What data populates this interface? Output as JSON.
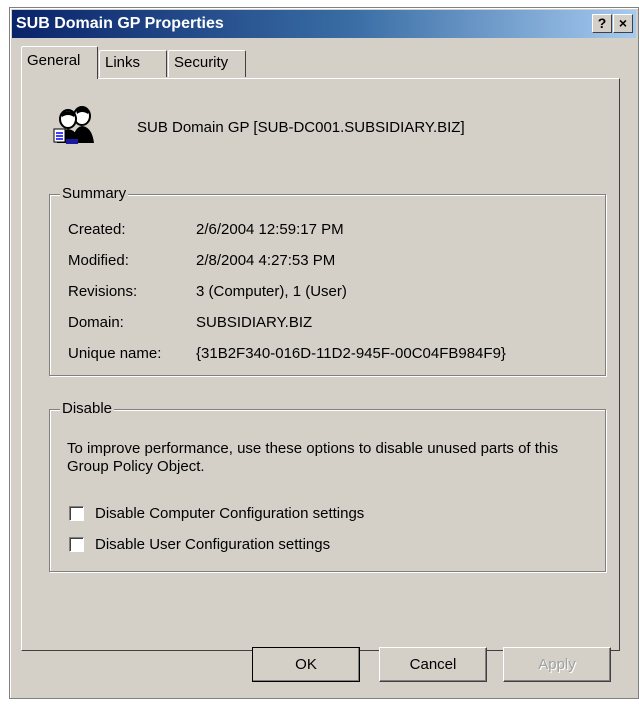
{
  "window": {
    "title": "SUB Domain GP Properties",
    "help_label": "?",
    "close_label": "×"
  },
  "tabs": [
    {
      "label": "General",
      "active": true
    },
    {
      "label": "Links",
      "active": false
    },
    {
      "label": "Security",
      "active": false
    }
  ],
  "header": {
    "icon": "group-policy-users-icon",
    "name": "SUB Domain GP [SUB-DC001.SUBSIDIARY.BIZ]"
  },
  "summary": {
    "legend": "Summary",
    "rows": [
      {
        "label": "Created:",
        "value": "2/6/2004 12:59:17 PM"
      },
      {
        "label": "Modified:",
        "value": "2/8/2004 4:27:53 PM"
      },
      {
        "label": "Revisions:",
        "value": "3 (Computer), 1 (User)"
      },
      {
        "label": "Domain:",
        "value": "SUBSIDIARY.BIZ"
      },
      {
        "label": "Unique name:",
        "value": "{31B2F340-016D-11D2-945F-00C04FB984F9}"
      }
    ]
  },
  "disable": {
    "legend": "Disable",
    "description": "To improve performance, use these options to disable unused parts of this Group Policy Object.",
    "options": [
      {
        "label": "Disable Computer Configuration settings",
        "checked": false
      },
      {
        "label": "Disable User Configuration settings",
        "checked": false
      }
    ]
  },
  "buttons": {
    "ok": "OK",
    "cancel": "Cancel",
    "apply": "Apply"
  }
}
